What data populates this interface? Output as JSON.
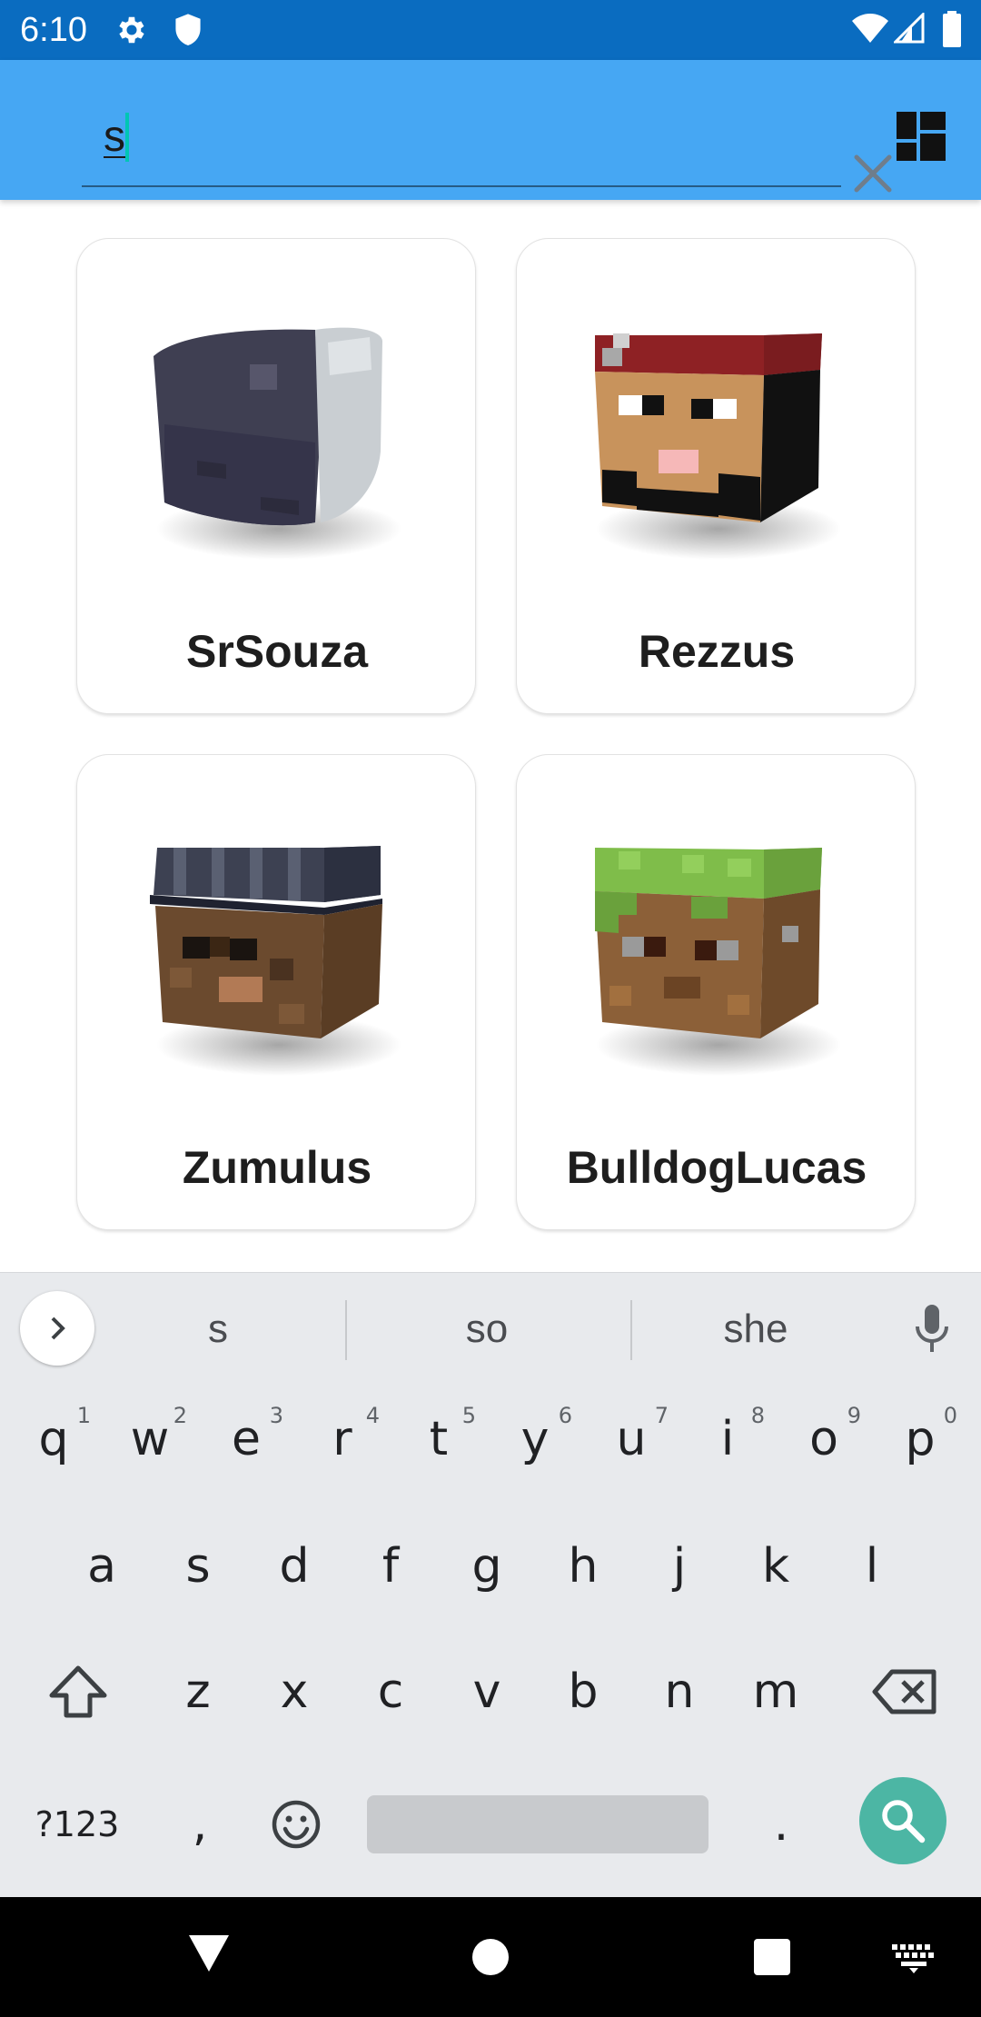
{
  "status_bar": {
    "time": "6:10",
    "icons": [
      "gear-icon",
      "shield-icon",
      "wifi-icon",
      "signal-icon",
      "battery-icon"
    ]
  },
  "search": {
    "value": "s",
    "clear_icon": "close-icon",
    "layout_icon": "dashboard-icon"
  },
  "results": [
    {
      "name": "SrSouza"
    },
    {
      "name": "Rezzus"
    },
    {
      "name": "Zumulus"
    },
    {
      "name": "BulldogLucas"
    }
  ],
  "keyboard": {
    "suggestions": [
      "s",
      "so",
      "she"
    ],
    "row1": [
      {
        "key": "q",
        "hint": "1"
      },
      {
        "key": "w",
        "hint": "2"
      },
      {
        "key": "e",
        "hint": "3"
      },
      {
        "key": "r",
        "hint": "4"
      },
      {
        "key": "t",
        "hint": "5"
      },
      {
        "key": "y",
        "hint": "6"
      },
      {
        "key": "u",
        "hint": "7"
      },
      {
        "key": "i",
        "hint": "8"
      },
      {
        "key": "o",
        "hint": "9"
      },
      {
        "key": "p",
        "hint": "0"
      }
    ],
    "row2": [
      "a",
      "s",
      "d",
      "f",
      "g",
      "h",
      "j",
      "k",
      "l"
    ],
    "row3": [
      "z",
      "x",
      "c",
      "v",
      "b",
      "n",
      "m"
    ],
    "symbols_label": "?123",
    "comma": ",",
    "period": "."
  },
  "colors": {
    "status_bar": "#0a6cc0",
    "app_bar": "#46a7f3",
    "caret": "#00c6b4",
    "search_key": "#4cb6a4"
  }
}
